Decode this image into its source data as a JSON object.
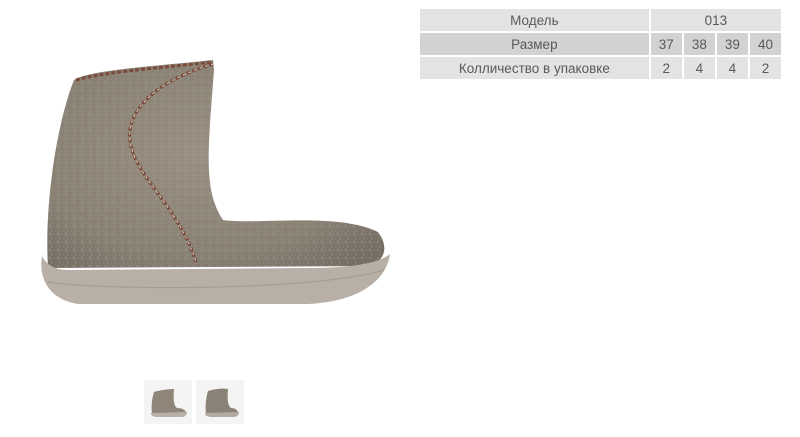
{
  "product_table": {
    "model_label": "Модель",
    "model_value": "013",
    "size_label": "Размер",
    "sizes": [
      "37",
      "38",
      "39",
      "40"
    ],
    "quantity_label": "Колличество в упаковке",
    "quantities": [
      "2",
      "4",
      "4",
      "2"
    ]
  },
  "gallery": {
    "main_image": "felt-boot-photo",
    "thumbnails": [
      "felt-boot-thumb-1",
      "felt-boot-thumb-2"
    ]
  },
  "colors": {
    "felt": "#8f8679",
    "sole": "#b8b0a6",
    "stitch": "#7a4a3a",
    "table_cell": "#e3e3e3",
    "table_cell_dark": "#d2d2d2"
  }
}
